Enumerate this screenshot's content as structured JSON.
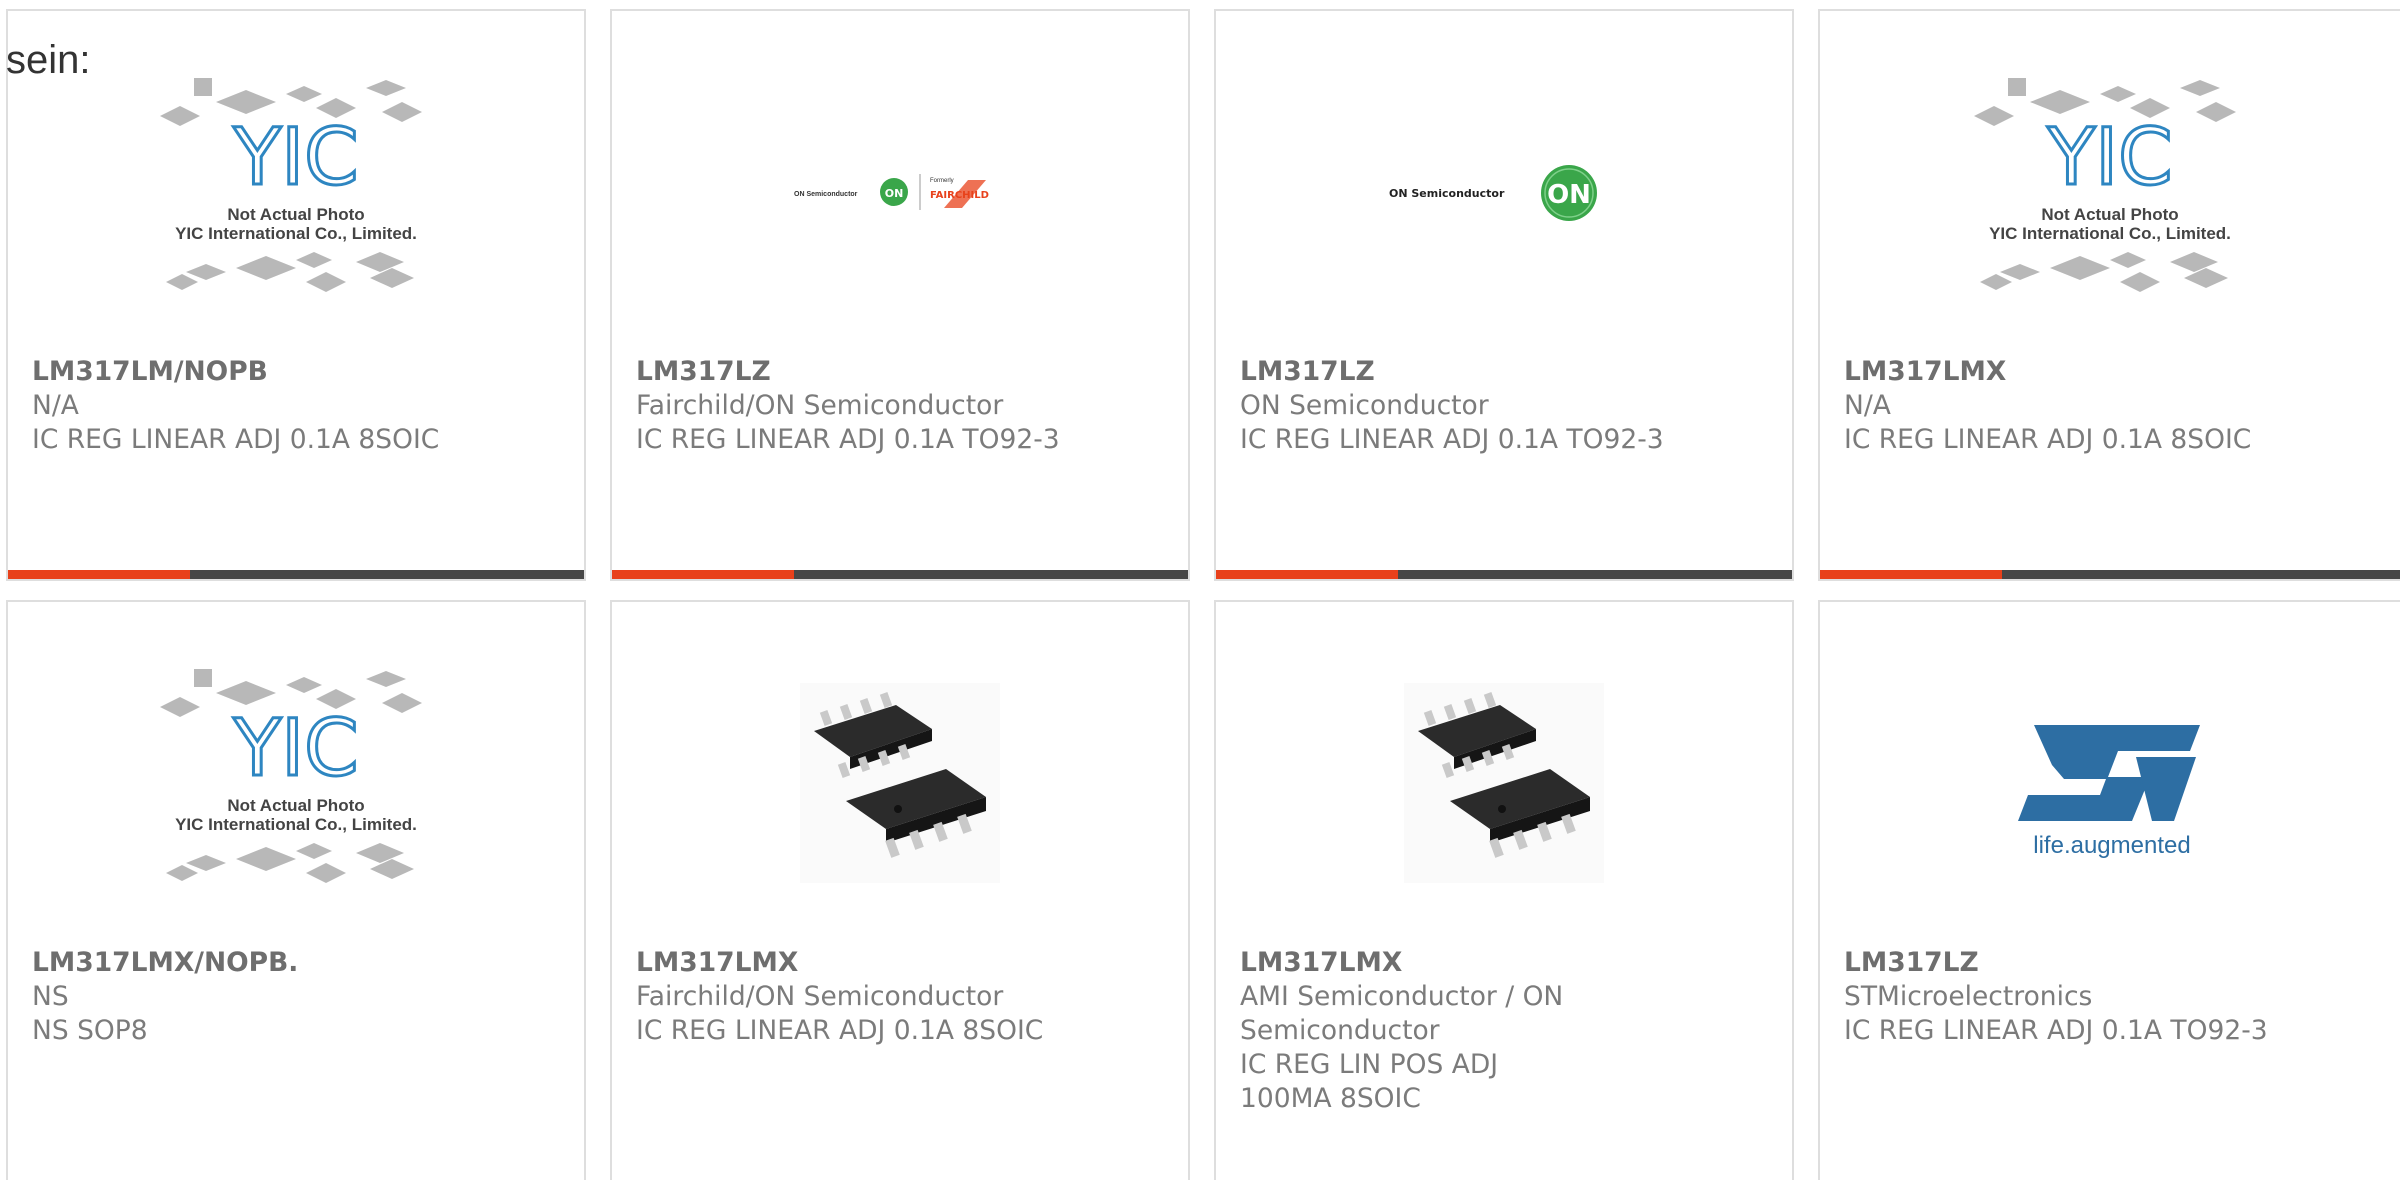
{
  "page": {
    "intro_text": "sein:"
  },
  "colors": {
    "accent": "#e8411b",
    "bar_dark": "#474747",
    "text_gray": "#7b7b7b",
    "card_border": "#dedede",
    "yic_blue": "#2e86c1",
    "st_blue": "#2d6ea3"
  },
  "placeholder": {
    "line1": "Not Actual Photo",
    "line2": "YIC International Co., Limited.",
    "logo_text": "YIC"
  },
  "logos": {
    "fairchild_on": {
      "brand": "ON Semiconductor",
      "badge": "ON",
      "formerly": "Formerly",
      "name": "FAIRCHILD"
    },
    "on": {
      "brand": "ON Semiconductor",
      "badge": "ON"
    },
    "st": {
      "mark": "ST",
      "tagline": "life.augmented"
    }
  },
  "products": [
    {
      "part": "LM317LM/NOPB",
      "maker": "N/A",
      "desc": "IC REG LINEAR ADJ 0.1A 8SOIC",
      "image": "yic-placeholder"
    },
    {
      "part": "LM317LZ",
      "maker": "Fairchild/ON Semiconductor",
      "desc": "IC REG LINEAR ADJ 0.1A TO92-3",
      "image": "fairchild-on-logo"
    },
    {
      "part": "LM317LZ",
      "maker": "ON Semiconductor",
      "desc": "IC REG LINEAR ADJ 0.1A TO92-3",
      "image": "on-semi-logo"
    },
    {
      "part": "LM317LMX",
      "maker": "N/A",
      "desc": "IC REG LINEAR ADJ 0.1A 8SOIC",
      "image": "yic-placeholder"
    },
    {
      "part": "LM317LMX/NOPB.",
      "maker": "NS",
      "desc": "NS SOP8",
      "image": "yic-placeholder"
    },
    {
      "part": "LM317LMX",
      "maker": "Fairchild/ON Semiconductor",
      "desc": "IC REG LINEAR ADJ 0.1A 8SOIC",
      "image": "soic8-chips"
    },
    {
      "part": "LM317LMX",
      "maker": "AMI Semiconductor / ON Semiconductor",
      "desc": "IC REG LIN POS ADJ 100MA 8SOIC",
      "image": "soic8-chips"
    },
    {
      "part": "LM317LZ",
      "maker": "STMicroelectronics",
      "desc": "IC REG LINEAR ADJ 0.1A TO92-3",
      "image": "st-logo"
    }
  ]
}
